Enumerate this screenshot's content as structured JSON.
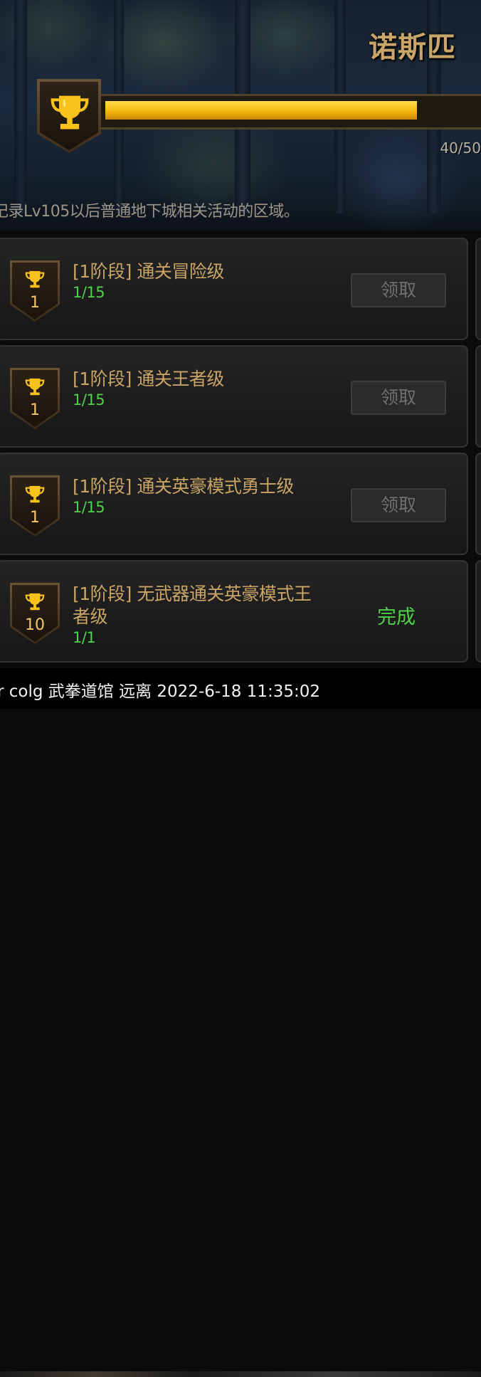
{
  "header": {
    "title": "诺斯匹",
    "progress": {
      "text": "40/50",
      "fraction": 0.8
    },
    "description": "记录Lv105以后普通地下城相关活动的区域。",
    "trophy_icon": "trophy-icon"
  },
  "tasks": [
    {
      "title": "[1阶段] 通关冒险级",
      "progress": "1/15",
      "count": "1",
      "action": "领取",
      "state": "claimable"
    },
    {
      "title": "[1阶段] 通关王者级",
      "progress": "1/15",
      "count": "1",
      "action": "领取",
      "state": "claimable"
    },
    {
      "title": "[1阶段] 通关英豪模式勇士级",
      "progress": "1/15",
      "count": "1",
      "action": "领取",
      "state": "claimable"
    },
    {
      "title": "[1阶段] 无武器通关英豪模式王者级",
      "progress": "1/1",
      "count": "10",
      "action": "完成",
      "state": "done"
    }
  ],
  "watermark": "r colg 武拳道馆 远离 2022-6-18 11:35:02",
  "colors": {
    "gold": "#f4b80f",
    "title_gold": "#c9a464",
    "progress_green": "#4fd14a"
  }
}
